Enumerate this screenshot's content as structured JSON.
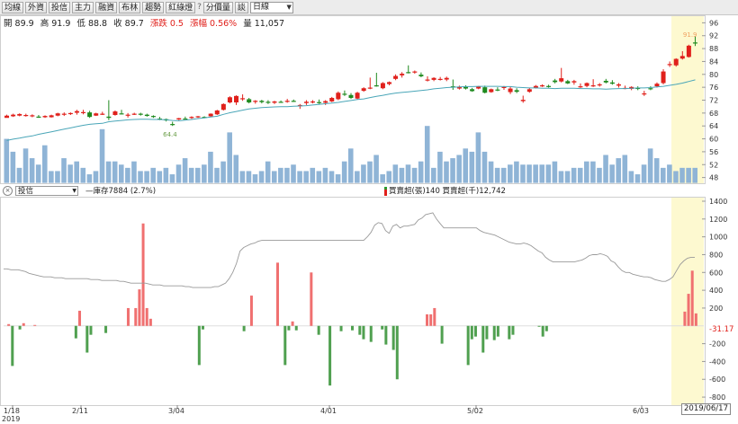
{
  "toolbar": {
    "buttons": [
      "均線",
      "外資",
      "投信",
      "主力",
      "融資",
      "布林",
      "趨勢",
      "紅綠燈"
    ],
    "separator": "?",
    "button_period": "分價量",
    "button_query": "談",
    "period_select": "日線"
  },
  "quote": {
    "open_label": "開",
    "open": "89.9",
    "high_label": "高",
    "high": "91.9",
    "low_label": "低",
    "low": "88.8",
    "close_label": "收",
    "close": "89.7",
    "change_label": "漲跌",
    "change": "0.5",
    "pct_label": "漲幅",
    "pct": "0.56%",
    "vol_label": "量",
    "volume": "11,057"
  },
  "sub_panel": {
    "select": "投信",
    "net_legend": "—庫存7884 (2.7%)",
    "buy_legend": "買賣超(張)140 買賣超(千)12,742"
  },
  "colors": {
    "up": "#f07070",
    "down": "#50a050",
    "ma": "#4aa6b8",
    "volume": "#8fb4d6",
    "net": "#999999",
    "highlight": "#fdf9d0"
  },
  "chart_data": [
    {
      "type": "candlestick",
      "y_ticks": [
        96,
        92,
        88,
        84,
        80,
        76,
        72,
        68,
        64,
        60,
        56,
        52,
        48
      ],
      "ylim": [
        46.5,
        97.5
      ],
      "annotations": [
        "64.4",
        "91.9"
      ],
      "candles": [
        [
          66.5,
          67.5,
          66.8,
          67.2
        ],
        [
          67,
          67.8,
          66.8,
          67.5
        ],
        [
          67.2,
          67.9,
          67,
          67.7
        ],
        [
          67.3,
          67.8,
          66.9,
          67.4
        ],
        [
          67,
          67.6,
          66.7,
          67.3
        ],
        [
          66.9,
          67.4,
          66.5,
          66.8
        ],
        [
          66.7,
          67.3,
          66.5,
          67.1
        ],
        [
          66.7,
          67.5,
          66.6,
          67.3
        ],
        [
          67.2,
          68.1,
          67,
          67.9
        ],
        [
          67.5,
          68.2,
          67.1,
          67.8
        ],
        [
          67.7,
          68.2,
          67.4,
          68
        ],
        [
          68.1,
          69,
          67.5,
          68.6
        ],
        [
          68,
          69,
          67.6,
          68.3
        ],
        [
          68.2,
          68.7,
          66.5,
          66.8
        ],
        [
          67.2,
          68.1,
          67.1,
          67.9
        ],
        [
          67.7,
          68.4,
          67.4,
          67.8
        ],
        [
          66.9,
          72,
          65.8,
          66.5
        ],
        [
          67.4,
          68.8,
          67.2,
          68.5
        ],
        [
          67.9,
          69,
          67.6,
          67.8
        ],
        [
          67.5,
          68,
          66.6,
          67.5
        ],
        [
          67.7,
          68.1,
          67.4,
          67.8
        ],
        [
          67.8,
          68.1,
          67.2,
          67.6
        ],
        [
          67.5,
          67.8,
          66.9,
          67.1
        ],
        [
          67.1,
          67.3,
          66.5,
          66.8
        ],
        [
          66.3,
          66.8,
          65.8,
          66.1
        ],
        [
          66.1,
          66.3,
          65.4,
          65.7
        ],
        [
          64.6,
          65.3,
          64,
          64.4
        ],
        [
          66,
          66.5,
          65.8,
          66.4
        ],
        [
          66.3,
          66.9,
          66,
          66.2
        ],
        [
          66.5,
          67,
          66.2,
          66.8
        ],
        [
          66.7,
          67.1,
          66.5,
          67
        ],
        [
          66.8,
          67,
          66.4,
          66.6
        ],
        [
          67,
          67.9,
          66.8,
          67.8
        ],
        [
          67.6,
          69,
          67.4,
          68.8
        ],
        [
          69,
          71,
          68.8,
          70.8
        ],
        [
          71.3,
          73.2,
          71,
          72.9
        ],
        [
          71.3,
          73.5,
          70.5,
          73.3
        ],
        [
          72.3,
          73.8,
          71.8,
          72.6
        ],
        [
          72.3,
          72.7,
          71,
          71.3
        ],
        [
          71.5,
          72,
          70.9,
          71.8
        ],
        [
          71.8,
          72.1,
          71,
          71.4
        ],
        [
          71.5,
          72,
          70.8,
          71.2
        ],
        [
          71.2,
          71.8,
          70.8,
          71.6
        ],
        [
          71.5,
          71.9,
          71.2,
          71.4
        ],
        [
          71.6,
          72.4,
          71.2,
          71.8
        ],
        [
          71.8,
          72.2,
          71.5,
          71.6
        ],
        [
          70.1,
          70.8,
          69.3,
          70.5
        ],
        [
          71.1,
          72,
          70.5,
          71.5
        ],
        [
          71.4,
          72,
          71,
          71.6
        ],
        [
          71.4,
          72.2,
          70.8,
          71.1
        ],
        [
          71.2,
          72,
          70.5,
          71.7
        ],
        [
          71.6,
          73,
          71.4,
          72.7
        ],
        [
          72.3,
          74.7,
          72,
          74.3
        ],
        [
          74,
          75,
          73.3,
          73.8
        ],
        [
          73.6,
          74.2,
          72.4,
          72.7
        ],
        [
          72.5,
          74.6,
          72.3,
          74.3
        ],
        [
          74.9,
          76,
          74.6,
          75.7
        ],
        [
          75.7,
          79,
          75.4,
          75.9
        ],
        [
          76.6,
          80.5,
          76.2,
          76.5
        ],
        [
          75.7,
          77.6,
          75.4,
          77.3
        ],
        [
          77,
          77.8,
          76.6,
          77.6
        ],
        [
          78.6,
          80,
          78.2,
          79.5
        ],
        [
          79.7,
          80.7,
          79,
          80.2
        ],
        [
          80.7,
          82.8,
          80.3,
          80.4
        ],
        [
          80.6,
          81.2,
          80.2,
          80.9
        ],
        [
          79.9,
          80.6,
          79.1,
          79.4
        ],
        [
          78.2,
          79.4,
          77.8,
          78.4
        ],
        [
          78.3,
          79.1,
          77.9,
          78.9
        ],
        [
          78.4,
          79.2,
          78.1,
          78.6
        ],
        [
          78.4,
          79.3,
          77.9,
          78.9
        ],
        [
          76.3,
          78.4,
          75.2,
          75.9
        ],
        [
          75.6,
          76.5,
          75.3,
          76.1
        ],
        [
          76.1,
          76.6,
          75.3,
          75.6
        ],
        [
          75.4,
          75.8,
          74.6,
          74.8
        ],
        [
          75.6,
          76.4,
          75.4,
          76.3
        ],
        [
          76,
          76.5,
          74.1,
          74.3
        ],
        [
          74.5,
          75.6,
          74.3,
          75.4
        ],
        [
          75.3,
          76,
          74.8,
          75.1
        ],
        [
          75.8,
          76.4,
          75.2,
          76.1
        ],
        [
          74.5,
          76.2,
          73.9,
          75.6
        ],
        [
          75.1,
          75.7,
          74.2,
          74.6
        ],
        [
          71.7,
          73.4,
          71.2,
          72.1
        ],
        [
          74.6,
          75.8,
          74.3,
          75.4
        ],
        [
          75.9,
          76.7,
          75.6,
          76.4
        ],
        [
          76.3,
          76.9,
          76.1,
          76.6
        ],
        [
          76.4,
          76.8,
          75.9,
          76.2
        ],
        [
          78.1,
          78.6,
          77.2,
          77.6
        ],
        [
          77.8,
          82,
          77.5,
          78.8
        ],
        [
          77.9,
          78.3,
          77,
          77.2
        ],
        [
          77.5,
          78.3,
          76.8,
          77.9
        ],
        [
          76.2,
          77.2,
          75.8,
          76.3
        ],
        [
          76.4,
          77.5,
          76,
          77.3
        ],
        [
          76.3,
          78.5,
          76.1,
          76.6
        ],
        [
          76.6,
          77.3,
          76.2,
          76.9
        ],
        [
          78,
          78.6,
          77.2,
          77.5
        ],
        [
          77.5,
          78.2,
          76.8,
          77.1
        ],
        [
          76.5,
          77.3,
          75.9,
          76.9
        ],
        [
          75.7,
          76.5,
          75.4,
          75.8
        ],
        [
          75.5,
          76.3,
          75.1,
          76.1
        ],
        [
          75.8,
          76.3,
          75.1,
          75.5
        ],
        [
          73.8,
          74.9,
          73.3,
          74.1
        ],
        [
          75.7,
          76.3,
          75.1,
          75.5
        ],
        [
          76.3,
          77.5,
          75.9,
          77.1
        ],
        [
          77.3,
          81.6,
          76.9,
          80.9
        ],
        [
          82.9,
          84,
          82.3,
          83.2
        ],
        [
          82.8,
          85,
          82.4,
          84.8
        ],
        [
          84.9,
          87.2,
          84.6,
          85.7
        ],
        [
          85.4,
          89.2,
          85.2,
          88.9
        ],
        [
          89.9,
          91.9,
          88.8,
          89.7
        ]
      ],
      "moving_average": [
        59.5,
        59.9,
        60.2,
        60.6,
        60.9,
        61.4,
        61.8,
        62.2,
        62.6,
        63,
        63.4,
        63.8,
        64.2,
        64.5,
        64.7,
        64.8,
        65.3,
        65.5,
        65.7,
        65.9,
        66,
        66.1,
        66.1,
        66,
        66,
        65.9,
        65.7,
        65.6,
        65.8,
        66,
        66.3,
        66.5,
        66.8,
        67,
        67.6,
        68.1,
        68.5,
        68.9,
        69.3,
        69.5,
        69.7,
        69.8,
        69.9,
        70,
        70,
        70.1,
        70.2,
        70.3,
        70.5,
        70.7,
        70.9,
        71.1,
        71.3,
        71.6,
        71.9,
        72.2,
        72.4,
        72.8,
        73.2,
        73.5,
        73.9,
        74.2,
        74.4,
        74.6,
        74.8,
        75,
        75.2,
        75.5,
        75.7,
        75.9,
        76,
        76.1,
        76.2,
        76.2,
        76.3,
        76.3,
        76.3,
        76.3,
        76.2,
        76.2,
        76,
        75.9,
        75.8,
        75.8,
        75.7,
        75.7,
        75.6,
        75.7,
        75.7,
        75.7,
        75.6,
        75.6,
        75.5,
        75.5,
        75.4,
        75.5,
        75.6,
        75.6,
        75.7,
        75.8,
        75.8,
        75.9,
        76.1,
        76.3,
        76.6,
        76.9,
        77.3,
        77.8,
        78.3
      ],
      "volume_ticks": [
        48,
        52,
        56,
        60
      ],
      "volume_band_ylim": [
        48,
        64
      ],
      "volume": [
        60,
        56,
        51,
        57,
        54,
        52,
        58,
        50,
        50,
        54,
        52,
        53,
        51,
        49,
        50,
        63,
        53,
        53,
        52,
        51,
        53,
        50,
        50,
        51,
        50,
        51,
        49,
        52,
        54,
        51,
        51,
        52,
        56,
        51,
        53,
        62,
        55,
        50,
        50,
        49,
        50,
        53,
        50,
        51,
        51,
        52,
        50,
        50,
        51,
        50,
        51,
        50,
        49,
        53,
        57,
        50,
        52,
        53,
        55,
        49,
        50,
        52,
        51,
        52,
        51,
        53,
        64,
        51,
        56,
        53,
        54,
        55,
        57,
        56,
        62,
        56,
        53,
        51,
        51,
        52,
        53,
        52,
        52,
        52,
        52,
        52,
        53,
        50,
        50,
        51,
        51,
        53,
        53,
        51,
        55,
        52,
        54,
        55,
        50,
        49,
        52,
        57,
        54,
        51,
        52,
        50,
        51,
        51,
        51,
        52,
        51,
        51,
        50,
        50,
        50,
        50,
        50,
        50,
        50,
        50,
        60,
        56,
        58,
        63
      ]
    },
    {
      "type": "bar",
      "title": "投信",
      "y_ticks": [
        1400,
        1200,
        1000,
        800,
        600,
        400,
        200,
        -200,
        -400,
        -600,
        -800
      ],
      "ylim": [
        -880,
        1420
      ],
      "last_value_label": "-31.17",
      "values": [
        0,
        20,
        -450,
        0,
        -40,
        30,
        0,
        0,
        10,
        0,
        0,
        0,
        0,
        0,
        0,
        0,
        0,
        0,
        0,
        -140,
        170,
        0,
        -300,
        -100,
        0,
        0,
        0,
        -80,
        0,
        0,
        0,
        0,
        0,
        200,
        0,
        200,
        410,
        1150,
        200,
        80,
        0,
        0,
        0,
        0,
        0,
        0,
        0,
        0,
        0,
        0,
        0,
        0,
        -440,
        -40,
        0,
        0,
        0,
        0,
        0,
        0,
        0,
        0,
        0,
        0,
        -60,
        0,
        340,
        0,
        0,
        0,
        0,
        0,
        0,
        710,
        0,
        -440,
        -50,
        50,
        -50,
        0,
        0,
        0,
        600,
        0,
        -100,
        0,
        0,
        -670,
        0,
        0,
        -60,
        0,
        0,
        -50,
        0,
        -100,
        -150,
        0,
        -180,
        0,
        0,
        -40,
        -210,
        0,
        -270,
        -600,
        0,
        0,
        0,
        0,
        0,
        0,
        0,
        130,
        130,
        200,
        0,
        -200,
        0,
        0,
        0,
        0,
        0,
        0,
        -440,
        -150,
        -120,
        0,
        -300,
        -150,
        0,
        -160,
        -120,
        0,
        0,
        -150,
        -100,
        0,
        0,
        0,
        0,
        0,
        0,
        -10,
        -120,
        -60,
        0,
        0,
        0,
        0,
        0,
        0,
        0,
        0,
        0,
        0,
        0,
        0,
        0,
        0,
        0,
        0,
        0,
        0,
        0,
        0,
        0,
        0,
        0,
        0,
        0,
        0,
        0,
        0,
        0,
        0,
        0,
        0,
        0,
        0,
        0,
        0,
        160,
        360,
        620,
        140
      ],
      "holdings_line": [
        640,
        640,
        630,
        630,
        630,
        620,
        610,
        590,
        580,
        570,
        560,
        550,
        550,
        550,
        540,
        540,
        540,
        530,
        530,
        530,
        530,
        530,
        530,
        530,
        520,
        520,
        520,
        510,
        510,
        510,
        510,
        510,
        500,
        500,
        490,
        480,
        480,
        480,
        480,
        480,
        470,
        460,
        460,
        460,
        450,
        450,
        450,
        450,
        450,
        450,
        440,
        440,
        430,
        430,
        430,
        430,
        430,
        430,
        440,
        440,
        460,
        480,
        530,
        600,
        700,
        840,
        880,
        900,
        920,
        930,
        950,
        960,
        960,
        960,
        960,
        960,
        960,
        960,
        960,
        960,
        960,
        960,
        960,
        960,
        960,
        960,
        960,
        960,
        960,
        960,
        960,
        960,
        960,
        960,
        960,
        960,
        960,
        960,
        960,
        960,
        1000,
        1050,
        1130,
        1160,
        1150,
        1070,
        1040,
        1120,
        1140,
        1100,
        1120,
        1120,
        1130,
        1140,
        1190,
        1210,
        1250,
        1260,
        1270,
        1200,
        1150,
        1100,
        1100,
        1100,
        1100,
        1100,
        1100,
        1100,
        1100,
        1100,
        1100,
        1070,
        1050,
        1040,
        1030,
        1020,
        1000,
        980,
        960,
        940,
        930,
        920,
        920,
        930,
        920,
        900,
        870,
        840,
        820,
        770,
        740,
        720,
        720,
        720,
        720,
        720,
        720,
        720,
        730,
        740,
        760,
        790,
        800,
        800,
        810,
        800,
        780,
        730,
        710,
        660,
        620,
        600,
        600,
        580,
        570,
        560,
        550,
        550,
        540,
        520,
        510,
        500,
        500,
        520,
        550,
        620,
        690,
        730,
        760,
        770,
        770
      ]
    }
  ],
  "x_axis": {
    "labels": [
      "1/18",
      "2/11",
      "3/04",
      "4/01",
      "5/02",
      "6/03"
    ],
    "year": "2019",
    "end_date": "2019/06/17"
  }
}
